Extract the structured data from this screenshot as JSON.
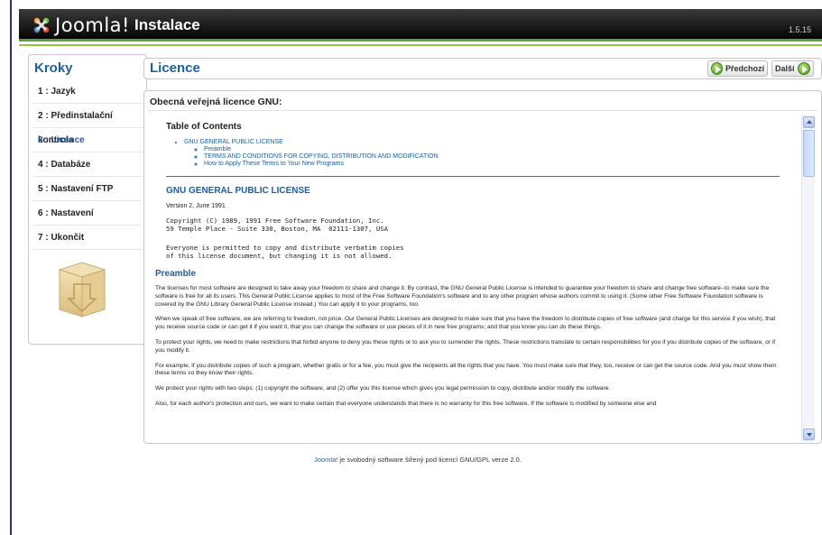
{
  "header": {
    "logo_text": "Joomla!",
    "title": "Instalace",
    "version": "1.5.15"
  },
  "sidebar": {
    "title": "Kroky",
    "steps": [
      {
        "label": "1 : Jazyk"
      },
      {
        "label": "2 : Předinstalační kontrola"
      },
      {
        "label": "3 : Licence"
      },
      {
        "label": "4 : Databáze"
      },
      {
        "label": "5 : Nastavení FTP"
      },
      {
        "label": "6 : Nastavení"
      },
      {
        "label": "7 : Ukončit"
      }
    ],
    "active_step": 2
  },
  "main": {
    "title": "Licence",
    "prev_label": "Předchozí",
    "next_label": "Další",
    "panel_title": "Obecná veřejná licence GNU:"
  },
  "license": {
    "toc_heading": "Table of Contents",
    "toc_main": "GNU GENERAL PUBLIC LICENSE",
    "toc_sub": [
      "Preamble",
      "TERMS AND CONDITIONS FOR COPYING, DISTRIBUTION AND MODIFICATION",
      "How to Apply These Terms to Your New Programs"
    ],
    "heading": "GNU GENERAL PUBLIC LICENSE",
    "version_line": "Version 2, June 1991",
    "copyright": "Copyright (C) 1989, 1991 Free Software Foundation, Inc.\n59 Temple Place - Suite 330, Boston, MA  02111-1307, USA",
    "verbatim": "Everyone is permitted to copy and distribute verbatim copies\nof this license document, but changing it is not allowed.",
    "preamble_heading": "Preamble",
    "paragraphs": [
      "The licenses for most software are designed to take away your freedom to share and change it. By contrast, the GNU General Public License is intended to guarantee your freedom to share and change free software--to make sure the software is free for all its users. This General Public License applies to most of the Free Software Foundation's software and to any other program whose authors commit to using it. (Some other Free Software Foundation software is covered by the GNU Library General Public License instead.) You can apply it to your programs, too.",
      "When we speak of free software, we are referring to freedom, not price. Our General Public Licenses are designed to make sure that you have the freedom to distribute copies of free software (and charge for this service if you wish), that you receive source code or can get it if you want it, that you can change the software or use pieces of it in new free programs; and that you know you can do these things.",
      "To protect your rights, we need to make restrictions that forbid anyone to deny you these rights or to ask you to surrender the rights. These restrictions translate to certain responsibilities for you if you distribute copies of the software, or if you modify it.",
      "For example, if you distribute copies of such a program, whether gratis or for a fee, you must give the recipients all the rights that you have. You must make sure that they, too, receive or can get the source code. And you must show them these terms so they know their rights.",
      "We protect your rights with two steps: (1) copyright the software, and (2) offer you this license which gives you legal permission to copy, distribute and/or modify the software.",
      "Also, for each author's protection and ours, we want to make certain that everyone understands that there is no warranty for this free software. If the software is modified by someone else and"
    ]
  },
  "footer": {
    "link": "Joomla!",
    "text": " je svobodný software šířený pod licencí GNU/GPL verze 2.0."
  },
  "colors": {
    "accent_blue": "#1a5fa8",
    "header_green": "#8cc63f",
    "header_black": "#050505"
  }
}
